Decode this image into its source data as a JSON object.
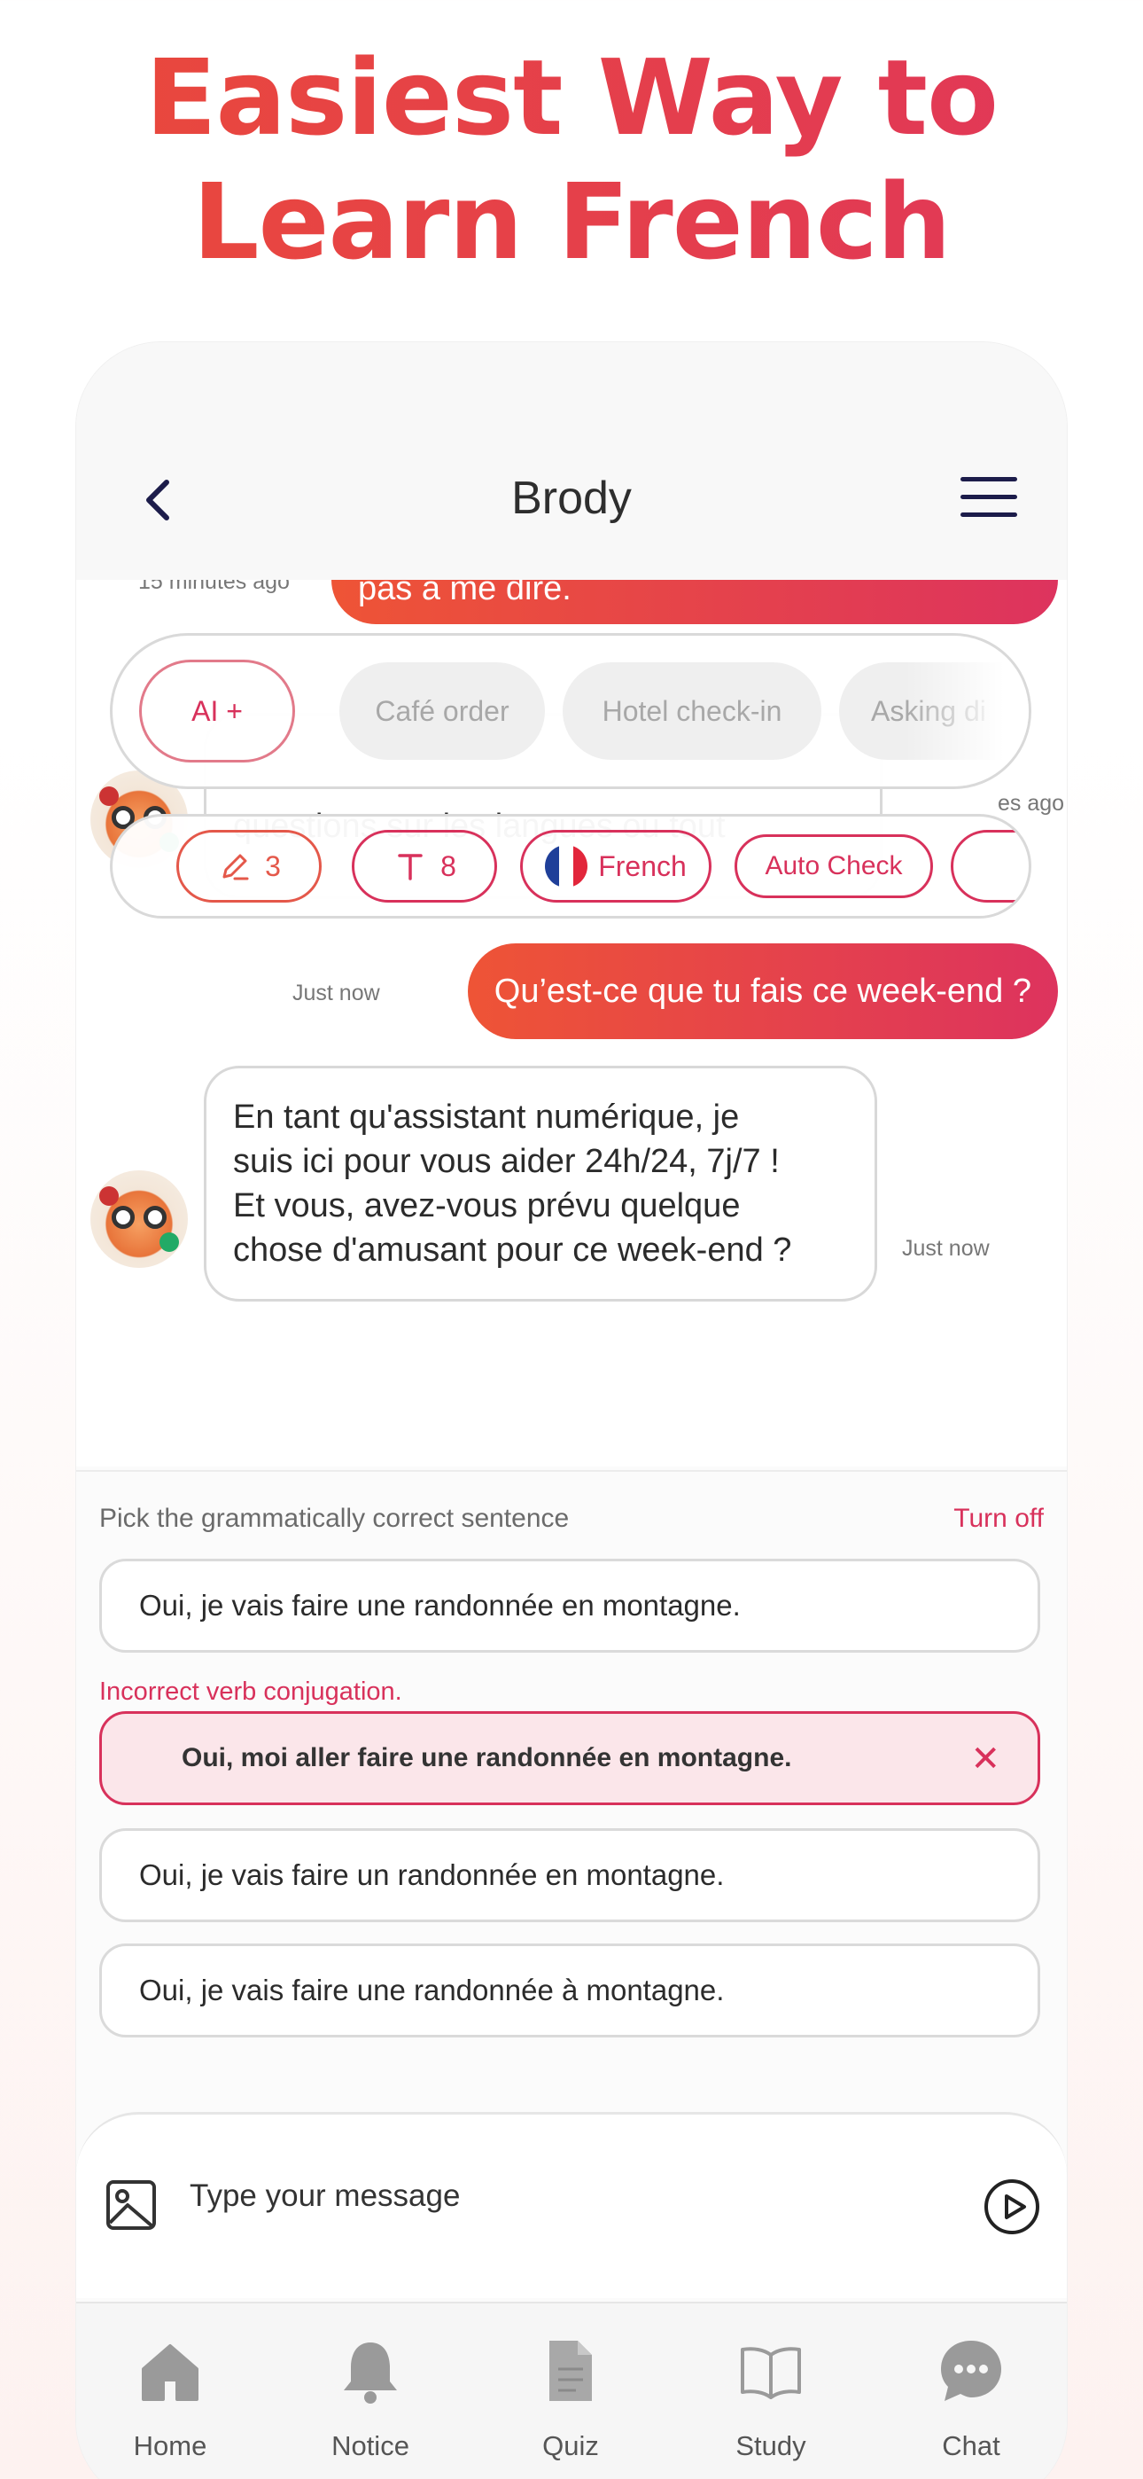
{
  "headline": {
    "line1": "Easiest Way to",
    "line2": "Learn French"
  },
  "navbar": {
    "title": "Brody",
    "back_icon": "chevron-left-icon",
    "menu_icon": "hamburger-icon"
  },
  "chat": {
    "partial_user_text": "pas à me dire.",
    "partial_ts": "15 minutes ago",
    "partial_bot_text_line": "questions sur les langues ou tout",
    "partial_bot_ts": "es ago",
    "user_message": {
      "text": "Qu’est-ce que tu fais ce week-end ?",
      "timestamp": "Just now"
    },
    "bot_message": {
      "lines": [
        "En tant qu'assistant numérique, je",
        "suis ici pour vous aider 24h/24, 7j/7 !",
        "Et vous, avez-vous prévu quelque",
        "chose d'amusant pour ce week-end ?"
      ],
      "timestamp": "Just now"
    }
  },
  "scenario_chips": {
    "ai": "AI +",
    "items": [
      "Café order",
      "Hotel check-in",
      "Asking di"
    ]
  },
  "settings_chips": {
    "edits": "3",
    "text_size": "8",
    "language": "French",
    "auto_check": "Auto Check"
  },
  "quiz": {
    "prompt": "Pick the grammatically correct sentence",
    "turn_off": "Turn off",
    "error": "Incorrect verb conjugation.",
    "options": [
      "Oui, je vais faire une randonnée en montagne.",
      "Oui, moi aller faire une randonnée en montagne.",
      "Oui, je vais faire un randonnée en montagne.",
      "Oui, je vais faire une randonnée à montagne."
    ]
  },
  "input": {
    "placeholder": "Type your message"
  },
  "tabs": [
    {
      "label": "Home",
      "icon": "home-icon"
    },
    {
      "label": "Notice",
      "icon": "bell-icon"
    },
    {
      "label": "Quiz",
      "icon": "document-icon"
    },
    {
      "label": "Study",
      "icon": "book-icon"
    },
    {
      "label": "Chat",
      "icon": "chat-bubble-icon"
    }
  ],
  "colors": {
    "accent_start": "#ee5436",
    "accent_end": "#dd335e",
    "pink": "#d8315b"
  }
}
